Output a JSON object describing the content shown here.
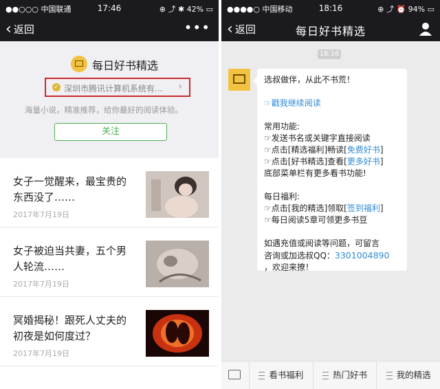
{
  "left": {
    "status": {
      "signal": "●●○○○ 中国联通",
      "time": "17:46",
      "right": "⊕ ⤴ ✱ 42% ▭"
    },
    "nav": {
      "back": "返回",
      "more": "•••"
    },
    "profile": {
      "name": "每日好书精选",
      "verify": "深圳市腾讯计算机系统有...",
      "description": "海量小说，精准推荐，给你最好的阅读体验。",
      "follow": "关注"
    },
    "articles": [
      {
        "title": "女子一觉醒来，最宝贵的东西没了……",
        "date": "2017年7月19日"
      },
      {
        "title": "女子被迫当共妻，五个男人轮流……",
        "date": "2017年7月19日"
      },
      {
        "title": "冥婚揭秘！跟死人丈夫的初夜是如何度过？",
        "date": "2017年7月19日"
      }
    ]
  },
  "right": {
    "status": {
      "signal": "●●●●○ 中国移动",
      "time": "18:16",
      "right": "⊕ ⤴ ⏰ 94% ▭"
    },
    "nav": {
      "back": "返回",
      "title": "每日好书精选"
    },
    "chat": {
      "time": "18:16",
      "message": {
        "l1": "选叔做伴，从此不书荒！",
        "l2": "☞戳我继续阅读",
        "l3": "常用功能:",
        "l4": "☞发送书名或关键字直接阅读",
        "l5a": "☞点击[精选福利]畅读[",
        "l5b": "免费好书",
        "l5c": "]",
        "l6a": "☞点击[好书精选]查看[",
        "l6b": "更多好书",
        "l6c": "]",
        "l7": "底部菜单栏有更多看书功能!",
        "l8": "每日福利:",
        "l9a": "☞点击[我的精选]领取[",
        "l9b": "签到福利",
        "l9c": "]",
        "l10": "☞每日阅读5章可领更多书豆",
        "l11": "如遇充值或阅读等问题，可留言",
        "l12a": "咨询或加选叔QQ：",
        "l12b": "3301004890",
        "l13": "，欢迎来撩！"
      }
    },
    "menu": [
      "看书福利",
      "热门好书",
      "我的精选"
    ]
  }
}
